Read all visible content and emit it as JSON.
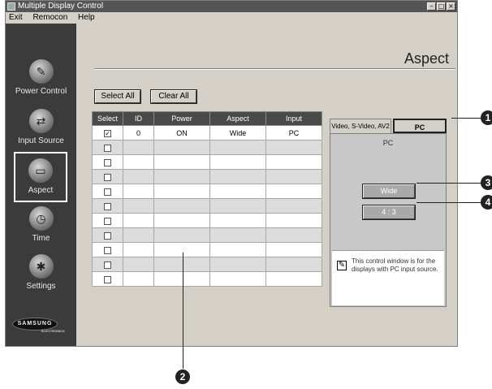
{
  "window": {
    "title": "Multiple Display Control",
    "min": "–",
    "max": "□",
    "close": "×"
  },
  "menu": [
    "Exit",
    "Remocon",
    "Help"
  ],
  "sidebar": [
    {
      "label": "Power Control",
      "glyph": "✎",
      "selected": false
    },
    {
      "label": "Input Source",
      "glyph": "⇄",
      "selected": false
    },
    {
      "label": "Aspect",
      "glyph": "▭",
      "selected": true
    },
    {
      "label": "Time",
      "glyph": "◷",
      "selected": false
    },
    {
      "label": "Settings",
      "glyph": "✱",
      "selected": false
    }
  ],
  "logo": {
    "brand": "SAMSUNG",
    "sub": "ELECTRONICS"
  },
  "page_title": "Aspect",
  "buttons": {
    "select_all": "Select All",
    "clear_all": "Clear All"
  },
  "table": {
    "headers": [
      "Select",
      "ID",
      "Power",
      "Aspect",
      "Input"
    ],
    "rows": [
      {
        "checked": true,
        "id": "0",
        "power": "ON",
        "aspect": "Wide",
        "input": "PC"
      },
      {
        "checked": false,
        "id": "",
        "power": "",
        "aspect": "",
        "input": ""
      },
      {
        "checked": false,
        "id": "",
        "power": "",
        "aspect": "",
        "input": ""
      },
      {
        "checked": false,
        "id": "",
        "power": "",
        "aspect": "",
        "input": ""
      },
      {
        "checked": false,
        "id": "",
        "power": "",
        "aspect": "",
        "input": ""
      },
      {
        "checked": false,
        "id": "",
        "power": "",
        "aspect": "",
        "input": ""
      },
      {
        "checked": false,
        "id": "",
        "power": "",
        "aspect": "",
        "input": ""
      },
      {
        "checked": false,
        "id": "",
        "power": "",
        "aspect": "",
        "input": ""
      },
      {
        "checked": false,
        "id": "",
        "power": "",
        "aspect": "",
        "input": ""
      },
      {
        "checked": false,
        "id": "",
        "power": "",
        "aspect": "",
        "input": ""
      },
      {
        "checked": false,
        "id": "",
        "power": "",
        "aspect": "",
        "input": ""
      }
    ]
  },
  "panel": {
    "tab_video": "Video, S-Video, AV2",
    "tab_pc": "PC",
    "subtitle": "PC",
    "btn_wide": "Wide",
    "btn_43": "4 : 3",
    "note": "This control window is for the displays with PC input source."
  },
  "callouts": [
    "1",
    "2",
    "3",
    "4"
  ],
  "colors": {
    "sidebar": "#3b3b3b",
    "window": "#d4d0c8",
    "header": "#4a4a4a"
  }
}
